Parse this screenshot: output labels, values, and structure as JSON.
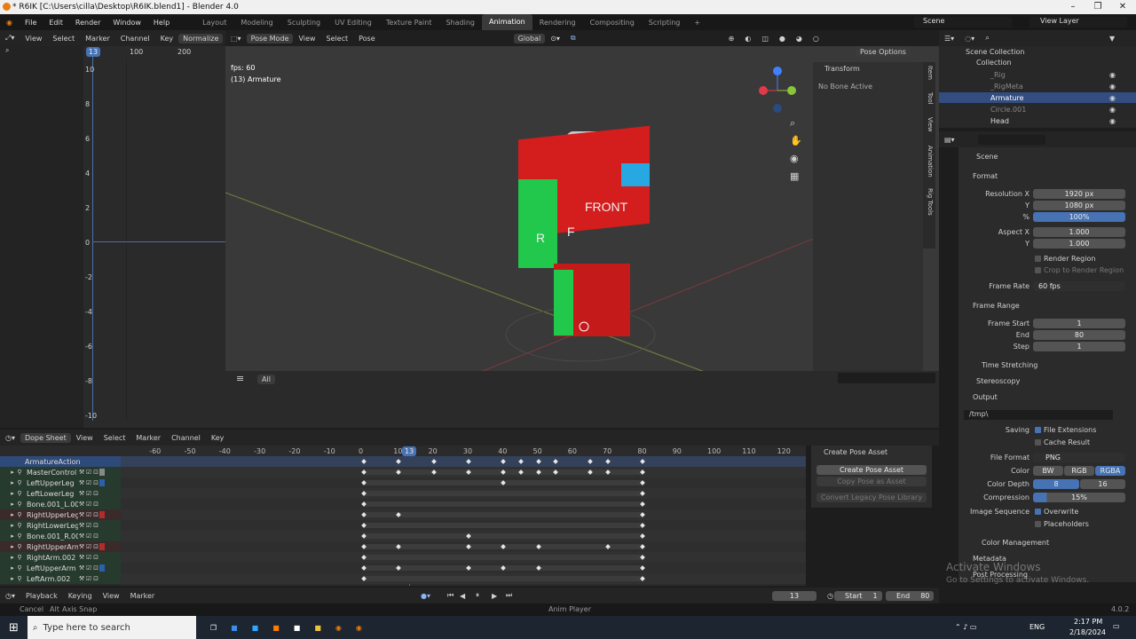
{
  "window": {
    "title": "* R6IK [C:\\Users\\cilla\\Desktop\\R6IK.blend1] - Blender 4.0"
  },
  "menu": {
    "items": [
      "File",
      "Edit",
      "Render",
      "Window",
      "Help"
    ],
    "workspaces": [
      "Layout",
      "Modeling",
      "Sculpting",
      "UV Editing",
      "Texture Paint",
      "Shading",
      "Animation",
      "Rendering",
      "Compositing",
      "Scripting",
      "+"
    ],
    "scene": "Scene",
    "view_layer": "View Layer"
  },
  "graph": {
    "menus": [
      "View",
      "Select",
      "Marker",
      "Channel",
      "Key"
    ],
    "normalize": "Normalize",
    "frame": "13",
    "ruler": [
      "100",
      "200"
    ],
    "yticks": [
      "10",
      "8",
      "6",
      "4",
      "2",
      "0",
      "-2",
      "-4",
      "-6",
      "-8",
      "-10"
    ]
  },
  "viewport": {
    "mode": "Pose Mode",
    "menus": [
      "View",
      "Select",
      "Pose"
    ],
    "orientation": "Global",
    "pose_options": "Pose Options",
    "fps": "fps: 60",
    "object": "(13) Armature",
    "transform_title": "Transform",
    "no_bone": "No Bone Active",
    "tabs": [
      "Item",
      "Tool",
      "View",
      "Animation",
      "Rig Tools"
    ],
    "footer_all": "All",
    "front_text": "FRONT",
    "r_text": "R",
    "f_text": "F"
  },
  "outliner": {
    "root": "Scene Collection",
    "collection": "Collection",
    "items": [
      {
        "name": "_Rig",
        "dim": true
      },
      {
        "name": "_RigMeta",
        "dim": true
      },
      {
        "name": "Armature",
        "dim": false,
        "selected": true
      },
      {
        "name": "Circle.001",
        "dim": true
      },
      {
        "name": "Head",
        "dim": false
      }
    ]
  },
  "properties": {
    "scene": "Scene",
    "format": "Format",
    "res_x_label": "Resolution X",
    "res_x": "1920 px",
    "y_label": "Y",
    "res_y": "1080 px",
    "pct_label": "%",
    "pct": "100%",
    "aspect_x_label": "Aspect X",
    "aspect_x": "1.000",
    "aspect_y": "1.000",
    "render_region": "Render Region",
    "crop": "Crop to Render Region",
    "frame_rate_label": "Frame Rate",
    "frame_rate": "60 fps",
    "frame_range": "Frame Range",
    "frame_start_label": "Frame Start",
    "frame_start": "1",
    "end_label": "End",
    "end": "80",
    "step_label": "Step",
    "step": "1",
    "time_stretching": "Time Stretching",
    "stereoscopy": "Stereoscopy",
    "output": "Output",
    "path": "/tmp\\",
    "saving": "Saving",
    "file_ext": "File Extensions",
    "cache": "Cache Result",
    "file_format_label": "File Format",
    "file_format": "PNG",
    "color_label": "Color",
    "color_opts": [
      "BW",
      "RGB",
      "RGBA"
    ],
    "depth_label": "Color Depth",
    "depth_opts": [
      "8",
      "16"
    ],
    "compression_label": "Compression",
    "compression": "15%",
    "image_seq": "Image Sequence",
    "overwrite": "Overwrite",
    "placeholders": "Placeholders",
    "color_mgmt": "Color Management",
    "metadata": "Metadata",
    "post": "Post Processing"
  },
  "dopesheet": {
    "mode": "Dope Sheet",
    "menus": [
      "View",
      "Select",
      "Marker",
      "Channel",
      "Key"
    ],
    "ruler": [
      "-60",
      "-50",
      "-40",
      "-30",
      "-20",
      "-10",
      "0",
      "10",
      "20",
      "30",
      "40",
      "50",
      "60",
      "70",
      "80",
      "90",
      "100",
      "110",
      "120"
    ],
    "current": "13",
    "action": "ArmatureAction",
    "channels": [
      "MasterControl",
      "LeftUpperLeg",
      "LeftLowerLeg",
      "Bone.001_L.002",
      "RightUpperLeg",
      "RightLowerLeg",
      "Bone.001_R.002",
      "RightUpperArm",
      "RightArm.002",
      "LeftUpperArm",
      "LeftArm.002"
    ],
    "channel_colors": [
      "#888888",
      "#2b5fb0",
      "",
      "",
      "#b52a2a",
      "",
      "",
      "#b52a2a",
      "",
      "#2b5fb0",
      ""
    ],
    "keys": [
      [
        0,
        10,
        20,
        30,
        40,
        45,
        50,
        55,
        65,
        70,
        80
      ],
      [
        0,
        40,
        80
      ],
      [
        0,
        80
      ],
      [
        0,
        80
      ],
      [
        0,
        10,
        80
      ],
      [
        0,
        80
      ],
      [
        0,
        30,
        80
      ],
      [
        0,
        10,
        30,
        40,
        50,
        70,
        80
      ],
      [
        0,
        80
      ],
      [
        0,
        10,
        30,
        40,
        50,
        80
      ],
      [
        0,
        80
      ]
    ],
    "pose_panel": "Create Pose Asset",
    "pose_btn": "Create Pose Asset",
    "copy_btn": "Copy Pose as Asset",
    "convert_btn": "Convert Legacy Pose Library"
  },
  "timeline": {
    "menus": [
      "Playback",
      "Keying",
      "View",
      "Marker"
    ],
    "frame": "13",
    "start_label": "Start",
    "start": "1",
    "end_label": "End",
    "end": "80"
  },
  "status": {
    "cancel": "Cancel",
    "alt": "Alt",
    "axis": "Axis Snap",
    "anim": "Anim Player",
    "version": "4.0.2",
    "activate": "Activate Windows",
    "activate_sub": "Go to Settings to activate Windows."
  },
  "taskbar": {
    "search": "Type here to search",
    "time": "2:17 PM",
    "date": "2/18/2024",
    "lang": "ENG"
  }
}
